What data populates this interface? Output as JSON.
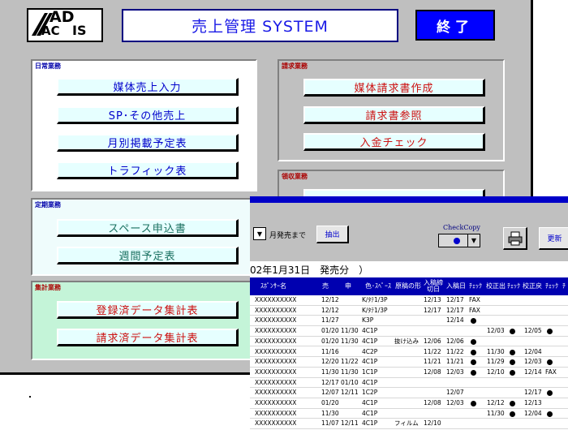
{
  "main": {
    "logo": {
      "line1": "AD",
      "line2": "AC",
      "suffix": "IS"
    },
    "title": "売上管理 SYSTEM",
    "end_button": "終了",
    "daily": {
      "label": "日常業務",
      "buttons": [
        "媒体売上入力",
        "SP･その他売上",
        "月別掲載予定表",
        "トラフィック表"
      ]
    },
    "billing": {
      "label": "請求業務",
      "buttons": [
        "媒体請求書作成",
        "請求書参照",
        "入金チェック"
      ]
    },
    "receipt": {
      "label": "領収業務"
    },
    "periodic": {
      "label": "定期業務",
      "buttons": [
        "スペース申込書",
        "週間予定表"
      ]
    },
    "summary": {
      "label": "集計業務",
      "buttons": [
        "登録済データ集計表",
        "請求済データ集計表"
      ]
    }
  },
  "overlay": {
    "month_label": "月発売まで",
    "extract_button": "抽出",
    "checkcopy_label": "CheckCopy",
    "update_button": "更新",
    "caption": "02年1月31日　発売分　）",
    "columns": [
      "ｽﾎﾟﾝｻｰ名",
      "売",
      "申",
      "色･ｽﾍﾟｰｽ",
      "原稿の形",
      "入稿締切日",
      "入稿日",
      "ﾁｪｯｸ",
      "校正出",
      "ﾁｪｯｸ",
      "校正戻",
      "ﾁｪｯｸ",
      "ﾁ"
    ],
    "rows": [
      {
        "sponsor": "XXXXXXXXXX",
        "uri": "12/12",
        "mou": "",
        "color": "K/ﾀﾃ1/3P",
        "genko": "",
        "shime": "12/13",
        "nyuko": "12/17",
        "c1": "FAX",
        "kousei_de": "",
        "c2": "",
        "kousei_modo": "",
        "c3": ""
      },
      {
        "sponsor": "XXXXXXXXXX",
        "uri": "12/12",
        "mou": "",
        "color": "K/ﾀﾃ1/3P",
        "genko": "",
        "shime": "12/17",
        "nyuko": "12/17",
        "c1": "FAX",
        "kousei_de": "",
        "c2": "",
        "kousei_modo": "",
        "c3": ""
      },
      {
        "sponsor": "XXXXXXXXXX",
        "uri": "11/27",
        "mou": "",
        "color": "K3P",
        "genko": "",
        "shime": "",
        "nyuko": "12/14",
        "c1": "●",
        "kousei_de": "",
        "c2": "",
        "kousei_modo": "",
        "c3": ""
      },
      {
        "sponsor": "XXXXXXXXXX",
        "uri": "01/20",
        "mou": "11/30",
        "color": "4C1P",
        "genko": "",
        "shime": "",
        "nyuko": "",
        "c1": "",
        "kousei_de": "12/03",
        "c2": "●",
        "kousei_modo": "12/05",
        "c3": "●"
      },
      {
        "sponsor": "XXXXXXXXXX",
        "uri": "01/20",
        "mou": "11/30",
        "color": "4C1P",
        "genko": "抜け込み",
        "shime": "12/06",
        "nyuko": "12/06",
        "c1": "●",
        "kousei_de": "",
        "c2": "",
        "kousei_modo": "",
        "c3": ""
      },
      {
        "sponsor": "XXXXXXXXXX",
        "uri": "11/16",
        "mou": "",
        "color": "4C2P",
        "genko": "",
        "shime": "11/22",
        "nyuko": "11/22",
        "c1": "●",
        "kousei_de": "11/30",
        "c2": "●",
        "kousei_modo": "12/04",
        "c3": ""
      },
      {
        "sponsor": "XXXXXXXXXX",
        "uri": "12/20",
        "mou": "11/22",
        "color": "4C1P",
        "genko": "",
        "shime": "11/21",
        "nyuko": "11/21",
        "c1": "●",
        "kousei_de": "11/29",
        "c2": "●",
        "kousei_modo": "12/03",
        "c3": "●"
      },
      {
        "sponsor": "XXXXXXXXXX",
        "uri": "11/30",
        "mou": "11/30",
        "color": "1C1P",
        "genko": "",
        "shime": "12/08",
        "nyuko": "12/03",
        "c1": "●",
        "kousei_de": "12/10",
        "c2": "●",
        "kousei_modo": "12/14",
        "c3": "FAX"
      },
      {
        "sponsor": "XXXXXXXXXX",
        "uri": "12/17",
        "mou": "01/10",
        "color": "4C1P",
        "genko": "",
        "shime": "",
        "nyuko": "",
        "c1": "",
        "kousei_de": "",
        "c2": "",
        "kousei_modo": "",
        "c3": ""
      },
      {
        "sponsor": "XXXXXXXXXX",
        "uri": "12/07",
        "mou": "12/11",
        "color": "1C2P",
        "genko": "",
        "shime": "",
        "nyuko": "12/07",
        "c1": "",
        "kousei_de": "",
        "c2": "",
        "kousei_modo": "12/17",
        "c3": "●"
      },
      {
        "sponsor": "XXXXXXXXXX",
        "uri": "01/20",
        "mou": "",
        "color": "4C1P",
        "genko": "",
        "shime": "12/08",
        "nyuko": "12/03",
        "c1": "●",
        "kousei_de": "12/12",
        "c2": "●",
        "kousei_modo": "12/13",
        "c3": ""
      },
      {
        "sponsor": "XXXXXXXXXX",
        "uri": "11/30",
        "mou": "",
        "color": "4C1P",
        "genko": "",
        "shime": "",
        "nyuko": "",
        "c1": "",
        "kousei_de": "11/30",
        "c2": "●",
        "kousei_modo": "12/04",
        "c3": "●"
      },
      {
        "sponsor": "XXXXXXXXXX",
        "uri": "11/07",
        "mou": "12/11",
        "color": "4C1P",
        "genko": "フィルム",
        "shime": "12/10",
        "nyuko": "",
        "c1": "",
        "kousei_de": "",
        "c2": "",
        "kousei_modo": "",
        "c3": ""
      }
    ]
  }
}
